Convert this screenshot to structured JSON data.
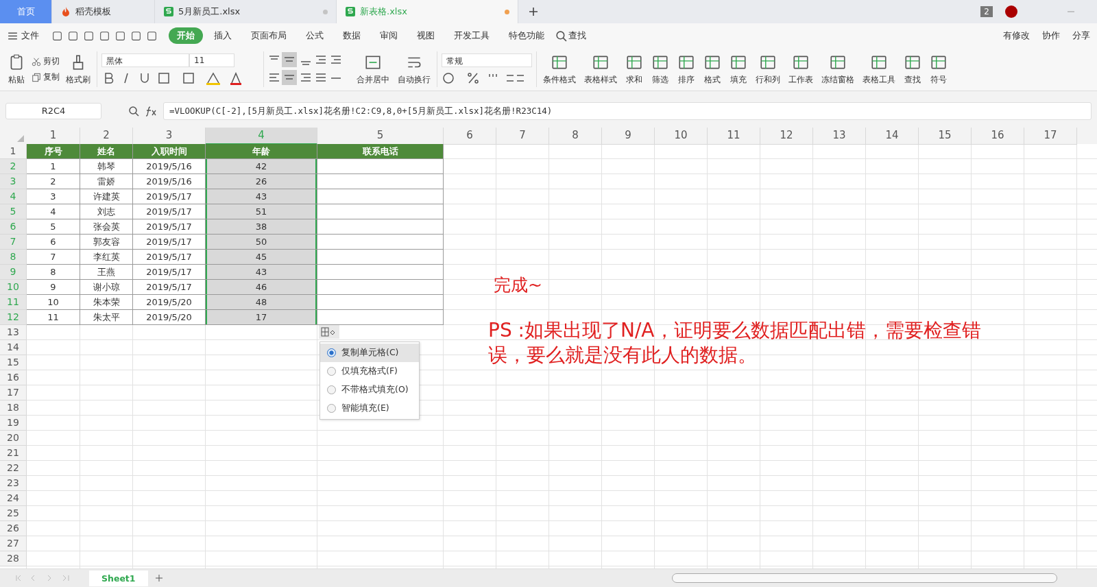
{
  "tabs": [
    {
      "label": "首页",
      "kind": "home",
      "selected": false
    },
    {
      "label": "稻壳模板",
      "kind": "template",
      "selected": false
    },
    {
      "label": "5月新员工.xlsx",
      "kind": "sheet",
      "selected": false,
      "unsaved": false
    },
    {
      "label": "新表格.xlsx",
      "kind": "sheet",
      "selected": true,
      "unsaved": true
    }
  ],
  "window_badge": "2",
  "menu": {
    "file": "文件",
    "ribbon_tabs": [
      {
        "label": "开始",
        "selected": true
      },
      {
        "label": "插入",
        "selected": false
      },
      {
        "label": "页面布局",
        "selected": false
      },
      {
        "label": "公式",
        "selected": false
      },
      {
        "label": "数据",
        "selected": false
      },
      {
        "label": "审阅",
        "selected": false
      },
      {
        "label": "视图",
        "selected": false
      },
      {
        "label": "开发工具",
        "selected": false
      },
      {
        "label": "特色功能",
        "selected": false
      }
    ],
    "search": "查找",
    "actions": [
      "有修改",
      "协作",
      "分享"
    ]
  },
  "toolbar": {
    "paste": "粘贴",
    "cut": "剪切",
    "copy": "复制",
    "format_painter": "格式刷",
    "font_name": "黑体",
    "font_size": "11",
    "merge": "合并居中",
    "wrap": "自动换行",
    "number_format": "常规",
    "buttons": [
      "条件格式",
      "表格样式",
      "求和",
      "筛选",
      "排序",
      "格式",
      "填充",
      "行和列",
      "工作表",
      "冻结窗格",
      "表格工具",
      "查找",
      "符号"
    ]
  },
  "formula_bar": {
    "name_box": "R2C4",
    "formula": "=VLOOKUP(C[-2],[5月新员工.xlsx]花名册!C2:C9,8,0+[5月新员工.xlsx]花名册!R23C14)"
  },
  "columns": [
    {
      "label": "1",
      "selected": false
    },
    {
      "label": "2",
      "selected": false
    },
    {
      "label": "3",
      "selected": false
    },
    {
      "label": "4",
      "selected": true
    },
    {
      "label": "5",
      "selected": false
    },
    {
      "label": "6",
      "selected": false
    },
    {
      "label": "7",
      "selected": false
    },
    {
      "label": "8",
      "selected": false
    },
    {
      "label": "9",
      "selected": false
    },
    {
      "label": "10",
      "selected": false
    },
    {
      "label": "11",
      "selected": false
    },
    {
      "label": "12",
      "selected": false
    },
    {
      "label": "13",
      "selected": false
    },
    {
      "label": "14",
      "selected": false
    },
    {
      "label": "15",
      "selected": false
    },
    {
      "label": "16",
      "selected": false
    },
    {
      "label": "17",
      "selected": false
    }
  ],
  "row_headers": [
    {
      "label": "1",
      "selected": false
    },
    {
      "label": "2",
      "selected": true
    },
    {
      "label": "3",
      "selected": true
    },
    {
      "label": "4",
      "selected": true
    },
    {
      "label": "5",
      "selected": true
    },
    {
      "label": "6",
      "selected": true
    },
    {
      "label": "7",
      "selected": true
    },
    {
      "label": "8",
      "selected": true
    },
    {
      "label": "9",
      "selected": true
    },
    {
      "label": "10",
      "selected": true
    },
    {
      "label": "11",
      "selected": true
    },
    {
      "label": "12",
      "selected": true
    },
    {
      "label": "13",
      "selected": false
    },
    {
      "label": "14",
      "selected": false
    },
    {
      "label": "15",
      "selected": false
    },
    {
      "label": "16",
      "selected": false
    },
    {
      "label": "17",
      "selected": false
    },
    {
      "label": "18",
      "selected": false
    },
    {
      "label": "19",
      "selected": false
    },
    {
      "label": "20",
      "selected": false
    },
    {
      "label": "21",
      "selected": false
    },
    {
      "label": "22",
      "selected": false
    },
    {
      "label": "23",
      "selected": false
    },
    {
      "label": "24",
      "selected": false
    },
    {
      "label": "25",
      "selected": false
    },
    {
      "label": "26",
      "selected": false
    },
    {
      "label": "27",
      "selected": false
    },
    {
      "label": "28",
      "selected": false
    }
  ],
  "table": {
    "header": [
      "序号",
      "姓名",
      "入职时间",
      "年龄",
      "联系电话"
    ],
    "rows": [
      [
        "1",
        "韩琴",
        "2019/5/16",
        "42"
      ],
      [
        "2",
        "雷娇",
        "2019/5/16",
        "26"
      ],
      [
        "3",
        "许建英",
        "2019/5/17",
        "43"
      ],
      [
        "4",
        "刘志",
        "2019/5/17",
        "51"
      ],
      [
        "5",
        "张会英",
        "2019/5/17",
        "38"
      ],
      [
        "6",
        "郭友容",
        "2019/5/17",
        "50"
      ],
      [
        "7",
        "李红英",
        "2019/5/17",
        "45"
      ],
      [
        "8",
        "王燕",
        "2019/5/17",
        "43"
      ],
      [
        "9",
        "谢小琼",
        "2019/5/17",
        "46"
      ],
      [
        "10",
        "朱本荣",
        "2019/5/20",
        "48"
      ],
      [
        "11",
        "朱太平",
        "2019/5/20",
        "17"
      ]
    ]
  },
  "paste_options": [
    {
      "label": "复制单元格(C)",
      "selected": true
    },
    {
      "label": "仅填充格式(F)",
      "selected": false
    },
    {
      "label": "不带格式填充(O)",
      "selected": false
    },
    {
      "label": "智能填充(E)",
      "selected": false
    }
  ],
  "notes": [
    "完成~",
    "PS :如果出现了N/A，证明要么数据匹配出错，需要检查错误，要么就是没有此人的数据。"
  ],
  "sheet_tabs": [
    {
      "label": "Sheet1",
      "selected": true
    }
  ]
}
